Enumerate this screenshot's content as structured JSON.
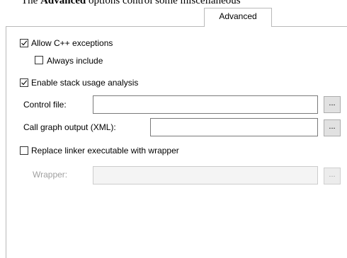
{
  "caption": {
    "prefix": "The ",
    "bold": "Advanced",
    "suffix": " options control some miscellaneous"
  },
  "tab": {
    "label": "Advanced"
  },
  "options": {
    "allow_cpp_exceptions": {
      "label": "Allow C++ exceptions",
      "checked": true
    },
    "always_include": {
      "label": "Always include",
      "checked": false
    },
    "enable_stack_usage": {
      "label": "Enable stack usage analysis",
      "checked": true
    },
    "control_file": {
      "label": "Control file:",
      "value": "",
      "button": "..."
    },
    "call_graph_output": {
      "label": "Call graph output (XML):",
      "value": "",
      "button": "..."
    },
    "replace_linker": {
      "label": "Replace linker executable with wrapper",
      "checked": false
    },
    "wrapper": {
      "label": "Wrapper:",
      "value": "",
      "button": "...",
      "disabled": true
    }
  }
}
